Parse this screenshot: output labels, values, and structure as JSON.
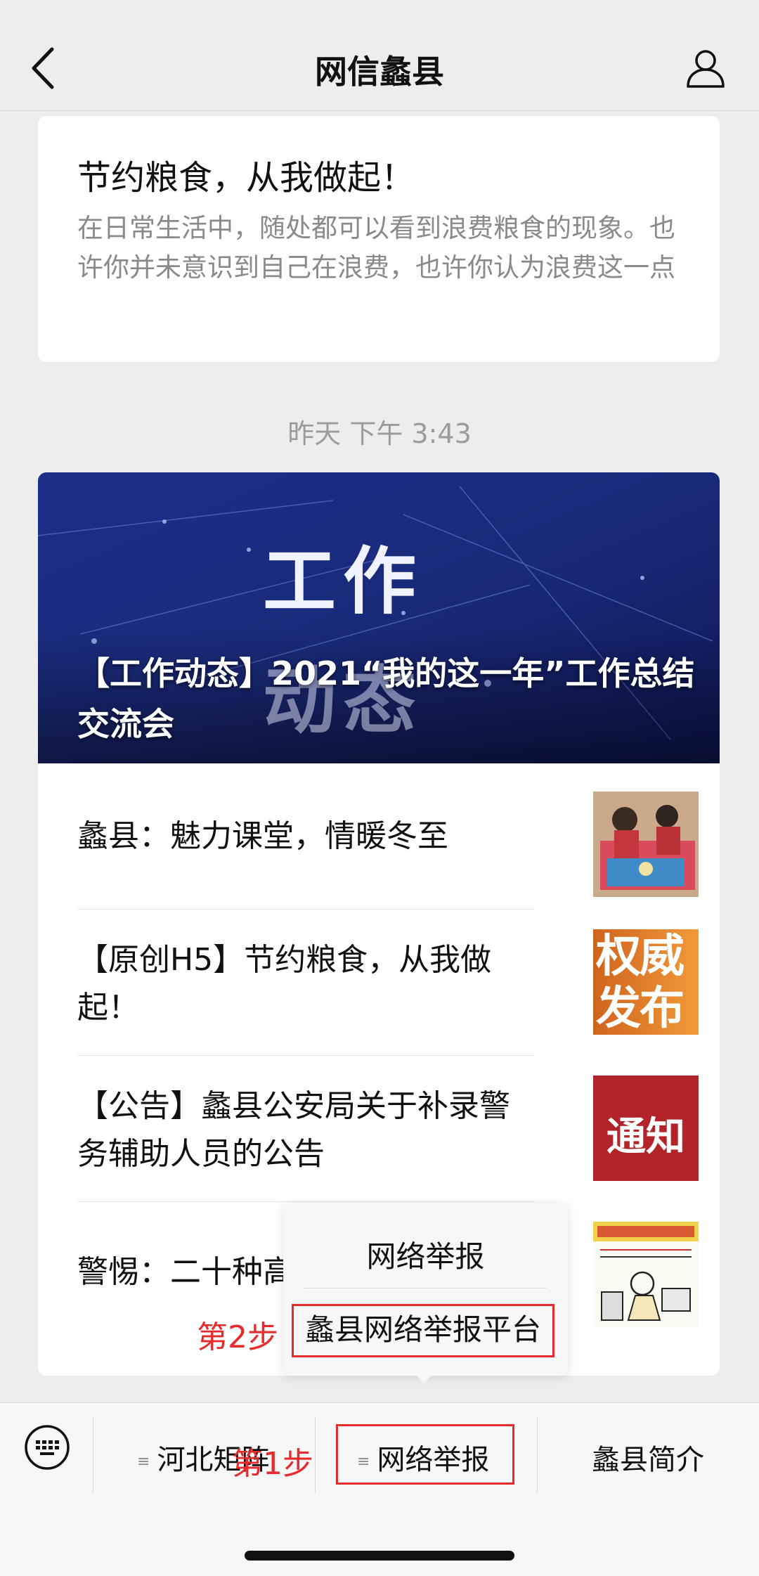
{
  "nav": {
    "title": "网信蠡县"
  },
  "card1": {
    "title": "节约粮食，从我做起！",
    "summary": "在日常生活中，随处都可以看到浪费粮食的现象。也许你并未意识到自己在浪费，也许你认为浪费这一点"
  },
  "timestamp": "昨天 下午 3:43",
  "card2": {
    "cover_title": "【工作动态】2021“我的这一年”工作总结交流会",
    "cover_image_text": [
      "工作",
      "动态"
    ],
    "items": [
      {
        "title": "蠡县：魅力课堂，情暖冬至",
        "thumb": "classroom-photo"
      },
      {
        "title": "【原创H5】节约粮食，从我做起！",
        "thumb_text": "权威发布"
      },
      {
        "title": "【公告】蠡县公安局关于补录警务辅助人员的公告",
        "thumb_text": "通知"
      },
      {
        "title": "警惕：二十种高",
        "thumb": "cartoon-warning"
      }
    ]
  },
  "popup": {
    "item1": "网络举报",
    "item2": "蠡县网络举报平台",
    "step_label": "第2步"
  },
  "bottom_menu": {
    "menu1": "河北矩阵",
    "menu2": "网络举报",
    "menu3": "蠡县简介",
    "step_label": "第1步"
  },
  "colors": {
    "highlight": "#e52b2b",
    "background": "#ededed"
  }
}
